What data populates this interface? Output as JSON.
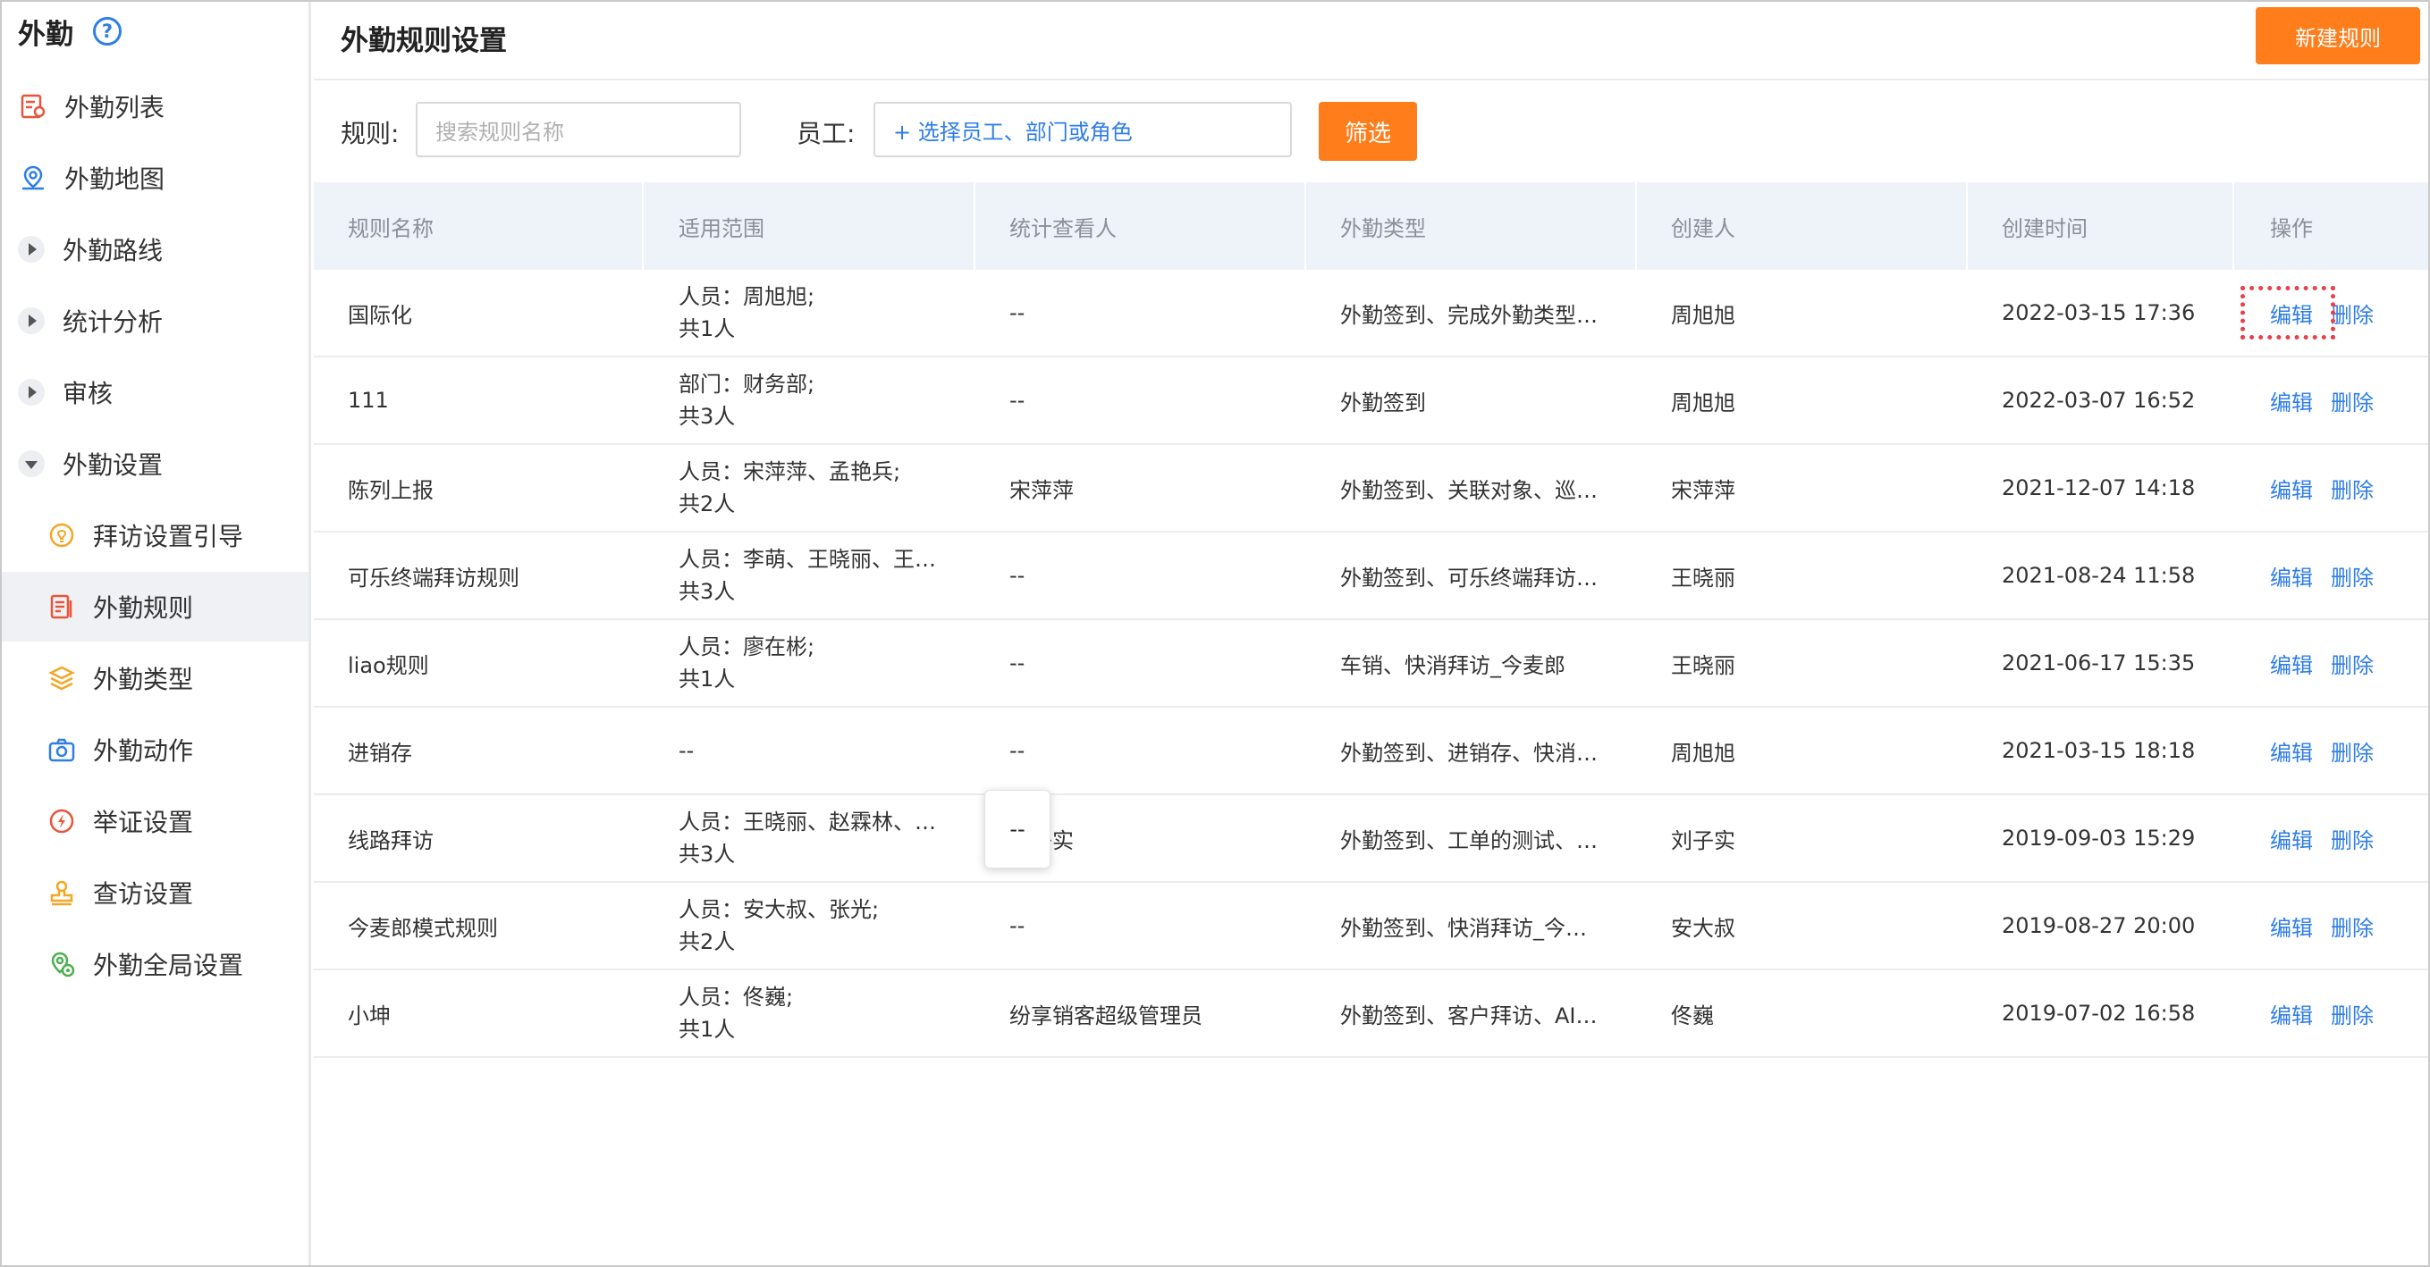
{
  "sidebar": {
    "title": "外勤",
    "help_glyph": "?",
    "items": [
      {
        "label": "外勤列表",
        "icon": "list-map-icon"
      },
      {
        "label": "外勤地图",
        "icon": "map-pin-icon"
      },
      {
        "label": "外勤路线",
        "icon": "expand-right-icon"
      },
      {
        "label": "统计分析",
        "icon": "expand-right-icon"
      },
      {
        "label": "审核",
        "icon": "expand-right-icon"
      },
      {
        "label": "外勤设置",
        "icon": "collapse-down-icon"
      },
      {
        "label": "拜访设置引导",
        "icon": "bulb-icon"
      },
      {
        "label": "外勤规则",
        "icon": "document-icon"
      },
      {
        "label": "外勤类型",
        "icon": "layers-icon"
      },
      {
        "label": "外勤动作",
        "icon": "camera-icon"
      },
      {
        "label": "举证设置",
        "icon": "lightning-icon"
      },
      {
        "label": "查访设置",
        "icon": "stamp-icon"
      },
      {
        "label": "外勤全局设置",
        "icon": "global-settings-icon"
      }
    ],
    "active_index": 7
  },
  "header": {
    "title": "外勤规则设置",
    "new_button": "新建规则"
  },
  "filters": {
    "rule_label": "规则:",
    "rule_placeholder": "搜索规则名称",
    "employee_label": "员工:",
    "employee_picker": "+ 选择员工、部门或角色",
    "filter_button": "筛选"
  },
  "table": {
    "headers": [
      "规则名称",
      "适用范围",
      "统计查看人",
      "外勤类型",
      "创建人",
      "创建时间",
      "操作"
    ],
    "rows": [
      {
        "name": "国际化",
        "scope_line1": "人员：周旭旭;",
        "scope_line2": "共1人",
        "viewer": "--",
        "type": "外勤签到、完成外勤类型…",
        "creator": "周旭旭",
        "time": "2022-03-15 17:36"
      },
      {
        "name": "111",
        "scope_line1": "部门：财务部;",
        "scope_line2": "共3人",
        "viewer": "--",
        "type": "外勤签到",
        "creator": "周旭旭",
        "time": "2022-03-07 16:52"
      },
      {
        "name": "陈列上报",
        "scope_line1": "人员：宋萍萍、孟艳兵;",
        "scope_line2": "共2人",
        "viewer": "宋萍萍",
        "type": "外勤签到、关联对象、巡…",
        "creator": "宋萍萍",
        "time": "2021-12-07 14:18"
      },
      {
        "name": "可乐终端拜访规则",
        "scope_line1": "人员：李萌、王晓丽、王…",
        "scope_line2": "共3人",
        "viewer": "--",
        "type": "外勤签到、可乐终端拜访…",
        "creator": "王晓丽",
        "time": "2021-08-24 11:58"
      },
      {
        "name": "liao规则",
        "scope_line1": "人员：廖在彬;",
        "scope_line2": "共1人",
        "viewer": "--",
        "type": "车销、快消拜访_今麦郎",
        "creator": "王晓丽",
        "time": "2021-06-17 15:35"
      },
      {
        "name": "进销存",
        "scope_line1": "--",
        "scope_line2": "",
        "viewer": "--",
        "type": "外勤签到、进销存、快消…",
        "creator": "周旭旭",
        "time": "2021-03-15 18:18"
      },
      {
        "name": "线路拜访",
        "scope_line1": "人员：王晓丽、赵霖林、…",
        "scope_line2": "共3人",
        "viewer": "刘子实",
        "type": "外勤签到、工单的测试、…",
        "creator": "刘子实",
        "time": "2019-09-03 15:29"
      },
      {
        "name": "今麦郎模式规则",
        "scope_line1": "人员：安大叔、张光;",
        "scope_line2": "共2人",
        "viewer": "--",
        "type": "外勤签到、快消拜访_今…",
        "creator": "安大叔",
        "time": "2019-08-27 20:00"
      },
      {
        "name": "小坤",
        "scope_line1": "人员：佟巍;",
        "scope_line2": "共1人",
        "viewer": "纷享销客超级管理员",
        "type": "外勤签到、客户拜访、AI…",
        "creator": "佟巍",
        "time": "2019-07-02 16:58"
      }
    ],
    "edit_label": "编辑",
    "delete_label": "删除"
  },
  "popover": {
    "text": "--"
  },
  "colors": {
    "accent_orange": "#ff7d1a",
    "link_blue": "#2f7ee6",
    "header_bg": "#eef3fa",
    "highlight_red": "#e8404a"
  }
}
